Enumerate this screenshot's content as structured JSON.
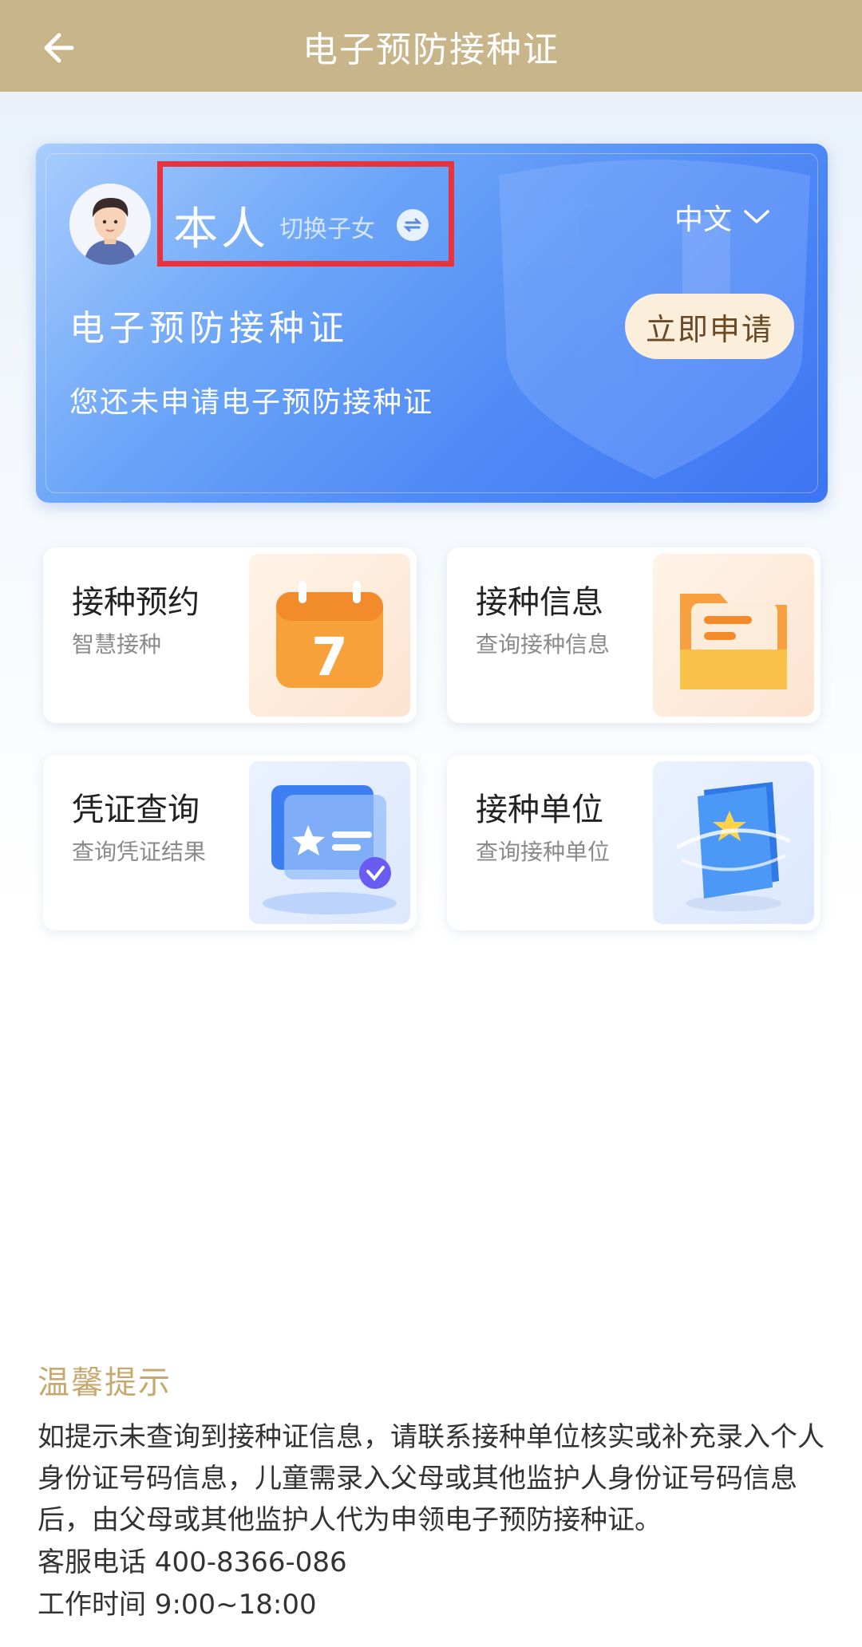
{
  "header": {
    "title": "电子预防接种证"
  },
  "hero": {
    "name": "本人",
    "switch_label": "切换子女",
    "language": "中文",
    "title": "电子预防接种证",
    "subtitle": "您还未申请电子预防接种证",
    "apply_label": "立即申请"
  },
  "tiles": [
    {
      "title": "接种预约",
      "subtitle": "智慧接种",
      "icon": "calendar-icon",
      "calendar_day": "7"
    },
    {
      "title": "接种信息",
      "subtitle": "查询接种信息",
      "icon": "folder-icon"
    },
    {
      "title": "凭证查询",
      "subtitle": "查询凭证结果",
      "icon": "certificate-icon"
    },
    {
      "title": "接种单位",
      "subtitle": "查询接种单位",
      "icon": "book-star-icon"
    }
  ],
  "tips": {
    "title": "温馨提示",
    "body": "如提示未查询到接种证信息，请联系接种单位核实或补充录入个人身份证号码信息，儿童需录入父母或其他监护人身份证号码信息后，由父母或其他监护人代为申领电子预防接种证。",
    "hotline": "客服电话 400-8366-086",
    "hours": "工作时间 9:00~18:00"
  },
  "colors": {
    "header_bg": "#c9b58a",
    "highlight_box": "#e8333f",
    "tips_title": "#c7a96f",
    "apply_button_bg": "#fbefdc"
  }
}
